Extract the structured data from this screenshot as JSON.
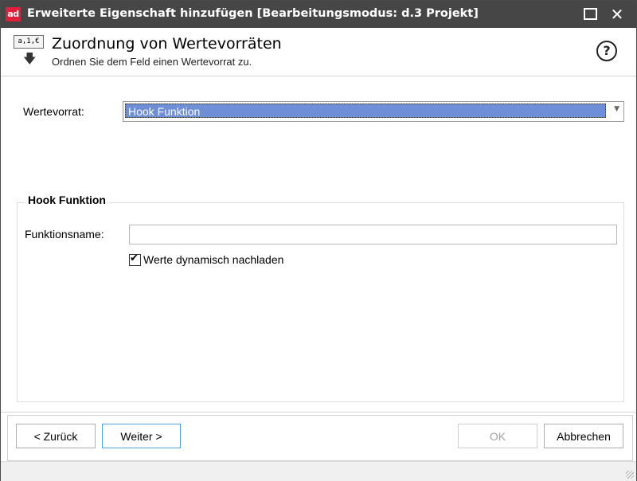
{
  "window": {
    "logo": "ad",
    "title": "Erweiterte Eigenschaft hinzufügen  [Bearbeitungsmodus: d.3 Projekt]",
    "maximize_icon": "maximize-icon",
    "close_label": "✕"
  },
  "header": {
    "icon_values": "a,1,€",
    "title": "Zuordnung von Wertevorräten",
    "subtitle": "Ordnen Sie dem Feld einen Wertevorrat zu.",
    "help_symbol": "?"
  },
  "form": {
    "wertevorrat_label": "Wertevorrat:",
    "wertevorrat_value": "Hook Funktion"
  },
  "group": {
    "title": "Hook Funktion",
    "funktionsname_label": "Funktionsname:",
    "funktionsname_value": "",
    "checkbox_label": "Werte dynamisch nachladen",
    "checkbox_checked": true
  },
  "footer": {
    "back_label": "< Zurück",
    "next_label": "Weiter >",
    "ok_label": "OK",
    "cancel_label": "Abbrechen"
  }
}
